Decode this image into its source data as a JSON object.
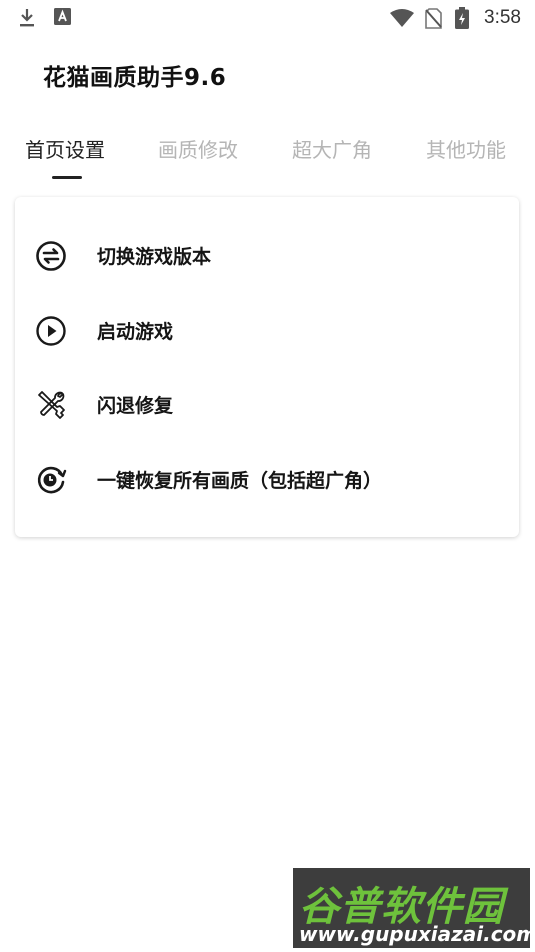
{
  "status_bar": {
    "time": "3:58",
    "icons": [
      "download-icon",
      "font-icon",
      "wifi-icon",
      "no-sim-icon",
      "battery-charging-icon"
    ]
  },
  "app": {
    "title": "花猫画质助手9.6"
  },
  "tabs": [
    {
      "label": "首页设置",
      "active": true
    },
    {
      "label": "画质修改",
      "active": false
    },
    {
      "label": "超大广角",
      "active": false
    },
    {
      "label": "其他功能",
      "active": false
    }
  ],
  "menu": [
    {
      "label": "切换游戏版本",
      "icon": "switch-arrows-icon"
    },
    {
      "label": "启动游戏",
      "icon": "play-circle-icon"
    },
    {
      "label": "闪退修复",
      "icon": "tools-icon"
    },
    {
      "label": "一键恢复所有画质（包括超广角）",
      "icon": "restore-icon"
    }
  ],
  "watermark": {
    "logo": "谷普软件园",
    "url": "www.gupuxiazai.com"
  },
  "colors": {
    "active_tab": "#222222",
    "inactive_tab": "#b5b5b5",
    "watermark_green": "#6ec23c",
    "watermark_bg": "#3d3d3d"
  }
}
